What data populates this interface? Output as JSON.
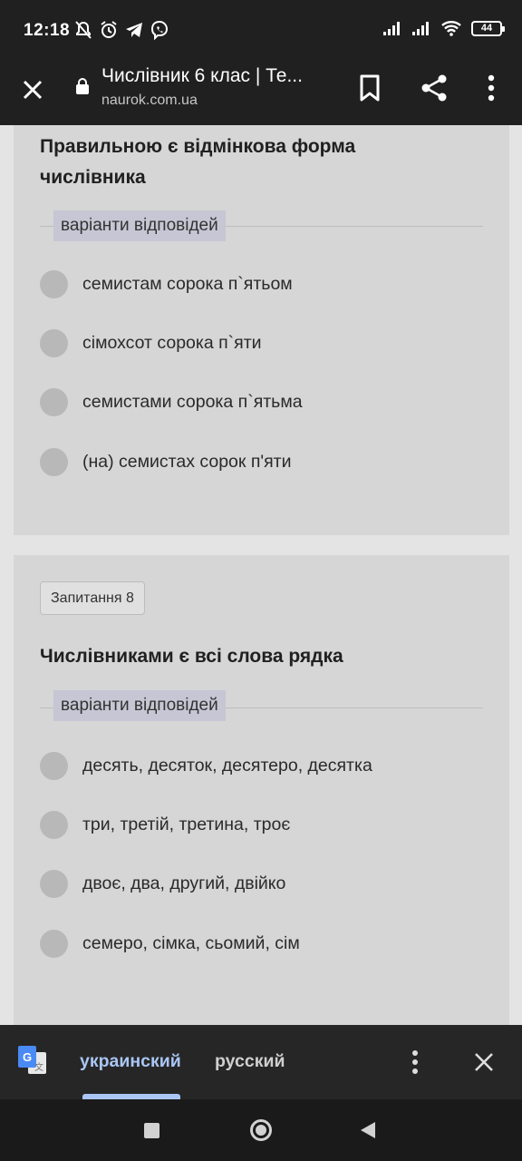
{
  "status_bar": {
    "time": "12:18",
    "battery": "44",
    "icons": [
      "notifications-off-icon",
      "alarm-icon",
      "telegram-icon",
      "viber-icon",
      "signal-icon",
      "signal-icon",
      "wifi-icon",
      "battery-icon"
    ]
  },
  "toolbar": {
    "title": "Числівник 6 клас | Те...",
    "url": "naurok.com.ua",
    "icons": [
      "close-icon",
      "lock-icon",
      "bookmark-icon",
      "share-icon",
      "more-vert-icon"
    ]
  },
  "questions": [
    {
      "text": "Правильною є відмінкова форма числівника",
      "answers_label": "варіанти відповідей",
      "options": [
        "семистам сорока п`ятьом",
        "сімохсот сорока п`яти",
        "семистами сорока п`ятьма",
        "(на) семистах сорок п'яти"
      ]
    },
    {
      "number_label": "Запитання 8",
      "text": "Числівниками є всі слова рядка",
      "answers_label": "варіанти відповідей",
      "options": [
        "десять, десяток, десятеро, десятка",
        "три, третій, третина, троє",
        "двоє, два, другий, двійко",
        "семеро, сімка, сьомий, сім"
      ]
    }
  ],
  "translate_bar": {
    "source_language": "украинский",
    "target_language": "русский",
    "icons": [
      "google-translate-icon",
      "more-vert-icon",
      "close-icon"
    ],
    "accent_color": "#a9c6f4"
  },
  "nav_bar": {
    "icons": [
      "recent-apps-icon",
      "home-icon",
      "back-icon"
    ]
  }
}
